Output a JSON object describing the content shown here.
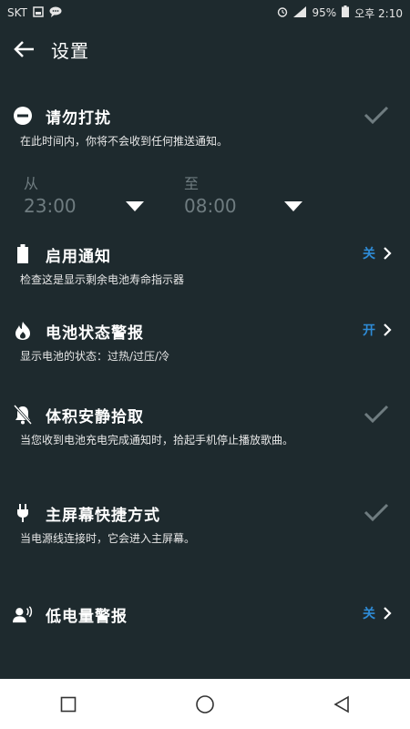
{
  "status_bar": {
    "carrier": "SKT",
    "battery_percent": "95%",
    "time": "오후 2:10",
    "icons": [
      "sim-icon",
      "message-icon",
      "alarm-icon",
      "signal-icon",
      "battery-icon"
    ]
  },
  "app_bar": {
    "title": "设置",
    "back_icon": "arrow-left-icon"
  },
  "settings": {
    "dnd": {
      "title": "请勿打扰",
      "desc": "在此时间内，你将不会收到任何推送通知。",
      "from_label": "从",
      "from_time": "23:00",
      "to_label": "至",
      "to_time": "08:00",
      "checked": true
    },
    "enable_notice": {
      "title": "启用通知",
      "desc": "检查这是显示剩余电池寿命指示器",
      "state": "关"
    },
    "battery_alert": {
      "title": "电池状态警报",
      "desc": "显示电池的状态：过热/过压/冷",
      "state": "开"
    },
    "quiet_pickup": {
      "title": "体积安静拾取",
      "desc": "当您收到电池充电完成通知时，拾起手机停止播放歌曲。",
      "checked": true
    },
    "home_shortcut": {
      "title": "主屏幕快捷方式",
      "desc": "当电源线连接时，它会进入主屏幕。",
      "checked": true
    },
    "low_battery": {
      "title": "低电量警报",
      "state": "关"
    }
  },
  "colors": {
    "background": "#1e2a2e",
    "accent": "#2e8bd6",
    "muted": "#6f7c80",
    "nav_bg": "#ffffff"
  }
}
